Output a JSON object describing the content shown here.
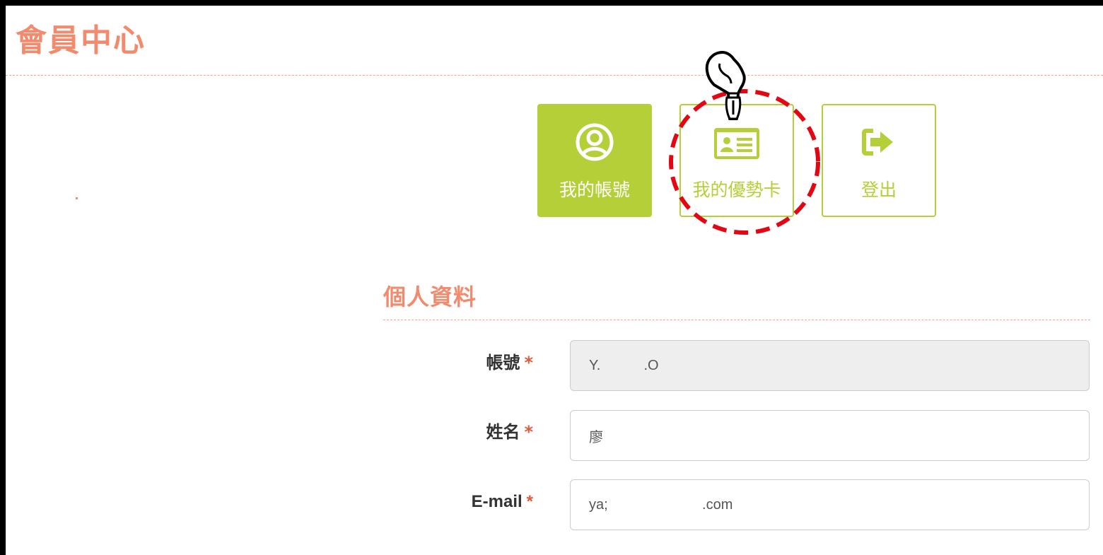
{
  "page": {
    "title": "會員中心",
    "accent_color": "#f28b6e",
    "brand_green": "#b5cf38"
  },
  "nav": {
    "buttons": [
      {
        "id": "account",
        "label": "我的帳號",
        "icon": "user-circle-icon",
        "active": true
      },
      {
        "id": "card",
        "label": "我的優勢卡",
        "icon": "id-card-icon",
        "active": false
      },
      {
        "id": "logout",
        "label": "登出",
        "icon": "sign-out-icon",
        "active": false
      }
    ]
  },
  "annotation": {
    "highlight": "red-dashed-circle-icon",
    "highlight_color": "#e30613",
    "cursor": "hand-pointer-icon"
  },
  "profile": {
    "section_title": "個人資料",
    "required_mark": "*",
    "fields": {
      "account": {
        "label": "帳號",
        "value": "Y.           .O",
        "readonly": true
      },
      "name": {
        "label": "姓名",
        "value": "廖"
      },
      "email": {
        "label": "E-mail",
        "value": "ya;                        .com"
      }
    }
  }
}
